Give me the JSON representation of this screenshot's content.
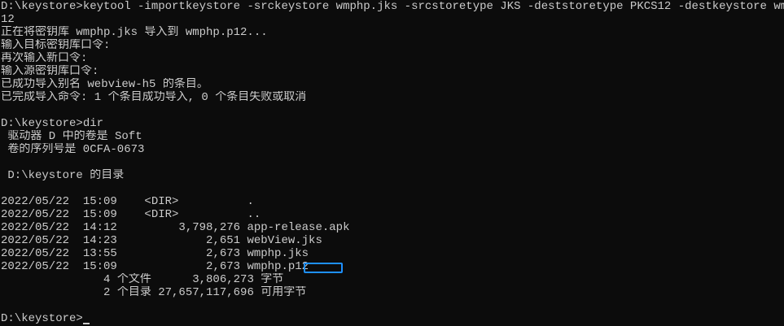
{
  "terminal": {
    "lines": [
      "D:\\keystore>keytool -importkeystore -srckeystore wmphp.jks -srcstoretype JKS -deststoretype PKCS12 -destkeystore wmphp.p",
      "12",
      "正在将密钥库 wmphp.jks 导入到 wmphp.p12...",
      "输入目标密钥库口令:",
      "再次输入新口令:",
      "输入源密钥库口令:",
      "已成功导入别名 webview-h5 的条目。",
      "已完成导入命令: 1 个条目成功导入, 0 个条目失败或取消",
      "",
      "D:\\keystore>dir",
      " 驱动器 D 中的卷是 Soft",
      " 卷的序列号是 0CFA-0673",
      "",
      " D:\\keystore 的目录",
      "",
      "2022/05/22  15:09    <DIR>          .",
      "2022/05/22  15:09    <DIR>          ..",
      "2022/05/22  14:12         3,798,276 app-release.apk",
      "2022/05/22  14:23             2,651 webView.jks",
      "2022/05/22  13:55             2,673 wmphp.jks",
      "2022/05/22  15:09             2,673 wmphp.p12",
      "               4 个文件      3,806,273 字节",
      "               2 个目录 27,657,117,696 可用字节",
      ""
    ],
    "prompt": "D:\\keystore>"
  },
  "colors": {
    "background": "#0c0c0c",
    "text": "#cccccc",
    "highlight": "#1e90ff"
  }
}
